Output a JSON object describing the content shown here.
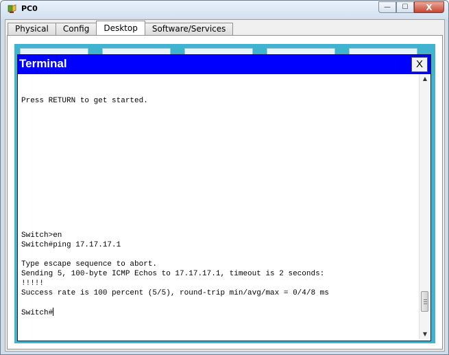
{
  "window": {
    "title": "PC0",
    "controls": {
      "minimize_glyph": "—",
      "maximize_glyph": "☐",
      "close_glyph": "X"
    }
  },
  "tabs": [
    {
      "label": "Physical",
      "active": false
    },
    {
      "label": "Config",
      "active": false
    },
    {
      "label": "Desktop",
      "active": true
    },
    {
      "label": "Software/Services",
      "active": false
    }
  ],
  "terminal": {
    "title": "Terminal",
    "close_label": "X",
    "lines": [
      "Press RETURN to get started.",
      "Switch>en",
      "Switch#ping 17.17.17.1",
      "Type escape sequence to abort.",
      "Sending 5, 100-byte ICMP Echos to 17.17.17.1, timeout is 2 seconds:",
      "!!!!!",
      "Success rate is 100 percent (5/5), round-trip min/avg/max = 0/4/8 ms",
      "Switch#"
    ]
  },
  "colors": {
    "terminal_title_bg": "#0000ff",
    "desktop_bg": "#3fb3cf",
    "close_button_red": "#c7452f"
  },
  "icons": {
    "app_icon": "packet-tracer-pc-icon",
    "scroll_up": "scroll-up-arrow-icon",
    "scroll_down": "scroll-down-arrow-icon"
  }
}
